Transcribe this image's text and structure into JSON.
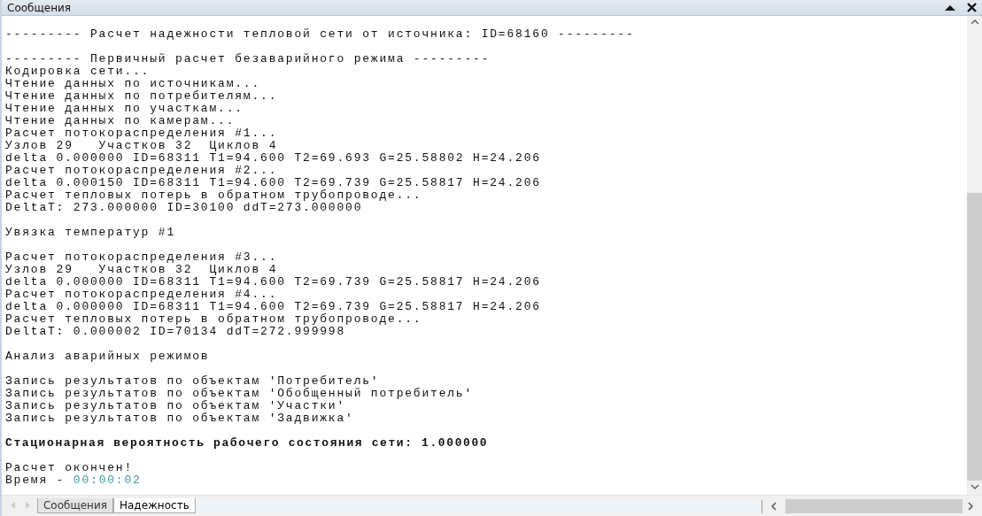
{
  "window": {
    "title": "Сообщения"
  },
  "log": [
    {
      "kind": "blank"
    },
    {
      "kind": "plain",
      "text": "--------- Расчет надежности тепловой сети от источника: ID=68160 ---------"
    },
    {
      "kind": "blank"
    },
    {
      "kind": "plain",
      "text": "--------- Первичный расчет безаварийного режима ---------"
    },
    {
      "kind": "plain",
      "text": "Кодировка сети..."
    },
    {
      "kind": "plain",
      "text": "Чтение данных по источникам..."
    },
    {
      "kind": "plain",
      "text": "Чтение данных по потребителям..."
    },
    {
      "kind": "plain",
      "text": "Чтение данных по участкам..."
    },
    {
      "kind": "plain",
      "text": "Чтение данных по камерам..."
    },
    {
      "kind": "plain",
      "text": "Расчет потокораспределения #1..."
    },
    {
      "kind": "plain",
      "text": "Узлов 29   Участков 32  Циклов 4"
    },
    {
      "kind": "plain",
      "text": "delta 0.000000 ID=68311 T1=94.600 T2=69.693 G=25.58802 H=24.206"
    },
    {
      "kind": "plain",
      "text": "Расчет потокораспределения #2..."
    },
    {
      "kind": "plain",
      "text": "delta 0.000150 ID=68311 T1=94.600 T2=69.739 G=25.58817 H=24.206"
    },
    {
      "kind": "plain",
      "text": "Расчет тепловых потерь в обратном трубопроводе..."
    },
    {
      "kind": "plain",
      "text": "DeltaT: 273.000000 ID=30100 ddT=273.000000"
    },
    {
      "kind": "blank"
    },
    {
      "kind": "plain",
      "text": "Увязка температур #1"
    },
    {
      "kind": "blank"
    },
    {
      "kind": "plain",
      "text": "Расчет потокораспределения #3..."
    },
    {
      "kind": "plain",
      "text": "Узлов 29   Участков 32  Циклов 4"
    },
    {
      "kind": "plain",
      "text": "delta 0.000000 ID=68311 T1=94.600 T2=69.739 G=25.58817 H=24.206"
    },
    {
      "kind": "plain",
      "text": "Расчет потокораспределения #4..."
    },
    {
      "kind": "plain",
      "text": "delta 0.000000 ID=68311 T1=94.600 T2=69.739 G=25.58817 H=24.206"
    },
    {
      "kind": "plain",
      "text": "Расчет тепловых потерь в обратном трубопроводе..."
    },
    {
      "kind": "plain",
      "text": "DeltaT: 0.000002 ID=70134 ddT=272.999998"
    },
    {
      "kind": "blank"
    },
    {
      "kind": "plain",
      "text": "Анализ аварийных режимов"
    },
    {
      "kind": "blank"
    },
    {
      "kind": "plain",
      "text": "Запись результатов по объектам 'Потребитель'"
    },
    {
      "kind": "plain",
      "text": "Запись результатов по объектам 'Обобщенный потребитель'"
    },
    {
      "kind": "plain",
      "text": "Запись результатов по объектам 'Участки'"
    },
    {
      "kind": "plain",
      "text": "Запись результатов по объектам 'Задвижка'"
    },
    {
      "kind": "blank"
    },
    {
      "kind": "bold",
      "text": "Стационарная вероятность рабочего состояния сети: 1.000000"
    },
    {
      "kind": "blank"
    },
    {
      "kind": "plain",
      "text": "Расчет окончен!"
    },
    {
      "kind": "timed",
      "text": "Время -",
      "time": "00:00:02"
    }
  ],
  "tabs": [
    {
      "label": "Сообщения",
      "selected": false
    },
    {
      "label": "Надежность",
      "selected": true
    }
  ]
}
